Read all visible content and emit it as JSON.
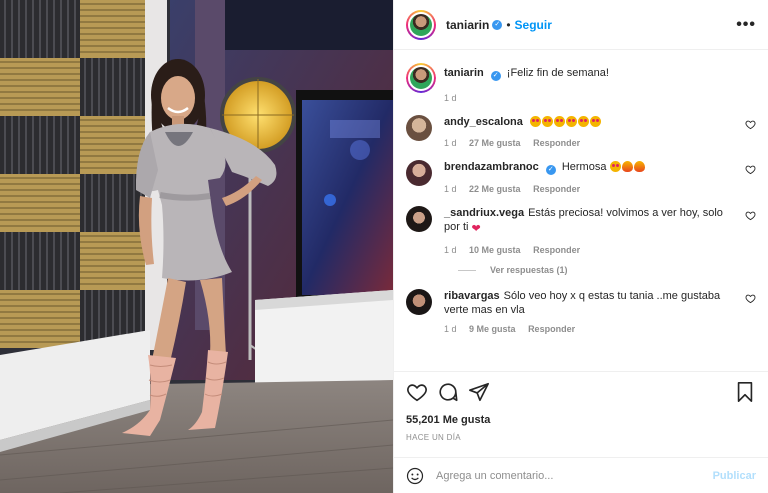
{
  "post": {
    "username": "taniarin",
    "follow_label": "Seguir",
    "more_label": "•••",
    "caption": "¡Feliz fin de semana!",
    "caption_time": "1 d",
    "likes": "55,201 Me gusta",
    "posted_ago": "HACE UN DÍA"
  },
  "comments": [
    {
      "username": "andy_escalona",
      "text": "",
      "emojis": [
        "eyes",
        "eyes",
        "eyes",
        "eyes",
        "eyes",
        "eyes"
      ],
      "time": "1 d",
      "likes": "27 Me gusta",
      "reply_label": "Responder",
      "avatar_color": "#b08a6e"
    },
    {
      "username": "brendazambranoc",
      "verified": true,
      "text": "Hermosa",
      "emojis": [
        "eyes",
        "fire",
        "fire"
      ],
      "time": "1 d",
      "likes": "22 Me gusta",
      "reply_label": "Responder",
      "avatar_color": "#7a5a60"
    },
    {
      "username": "_sandriux.vega",
      "text": "Estás preciosa! volvimos a ver hoy, solo por ti",
      "trailing_emoji": "❤",
      "time": "1 d",
      "likes": "10 Me gusta",
      "reply_label": "Responder",
      "view_replies": "Ver respuestas (1)",
      "avatar_color": "#3a2e2a"
    },
    {
      "username": "ribavargas",
      "text": "Sólo veo hoy x q estas tu tania ..me gustaba verte mas en vla",
      "time": "1 d",
      "likes": "9 Me gusta",
      "reply_label": "Responder",
      "avatar_color": "#2e2a28"
    }
  ],
  "add_comment": {
    "placeholder": "Agrega un comentario...",
    "publish_label": "Publicar"
  },
  "icons": {
    "like": "heart-icon",
    "comment": "comment-icon",
    "share": "paper-plane-icon",
    "save": "bookmark-icon",
    "emoji": "smiley-icon",
    "verified": "verified-badge-icon"
  },
  "colors": {
    "accent": "#0095f6",
    "verified": "#3897f0",
    "muted": "#8e8e8e",
    "publish_disabled": "#b2dffc"
  }
}
